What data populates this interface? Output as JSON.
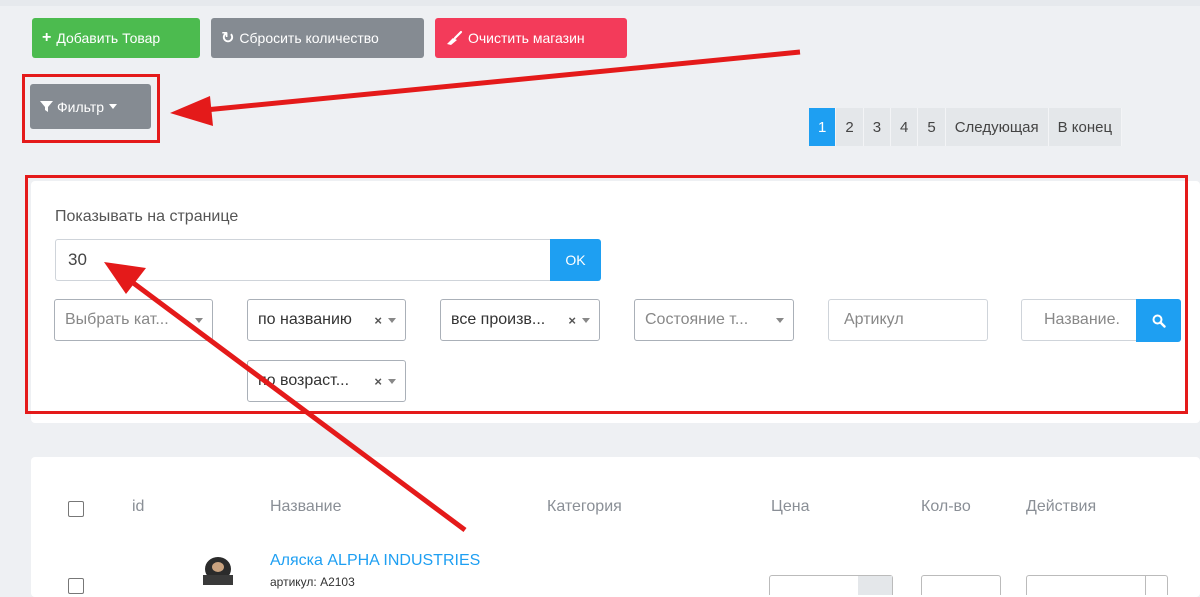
{
  "toolbar": {
    "add_label": "Добавить Товар",
    "reset_label": "Сбросить количество",
    "clear_label": "Очистить магазин",
    "filter_label": "Фильтр"
  },
  "pagination": {
    "pages": [
      "1",
      "2",
      "3",
      "4",
      "5"
    ],
    "active": "1",
    "next": "Следующая",
    "last": "В конец"
  },
  "filter": {
    "per_page_label": "Показывать на странице",
    "per_page_value": "30",
    "ok_label": "OK",
    "category_placeholder": "Выбрать кат...",
    "sort_value": "по названию",
    "manufacturer_value": "все произв...",
    "condition_placeholder": "Состояние т...",
    "sku_placeholder": "Артикул",
    "name_placeholder": "Название.",
    "age_value": "по возраст..."
  },
  "table": {
    "headers": {
      "id": "id",
      "name": "Название",
      "category": "Категория",
      "price": "Цена",
      "qty": "Кол-во",
      "actions": "Действия"
    },
    "row": {
      "name": "Аляска ALPHA INDUSTRIES",
      "sku": "артикул: A2103"
    }
  },
  "colors": {
    "primary": "#1e9ff2",
    "success": "#4cbb4f",
    "secondary": "#858b92",
    "danger": "#f33b5a",
    "annotation": "#e41a1a"
  }
}
